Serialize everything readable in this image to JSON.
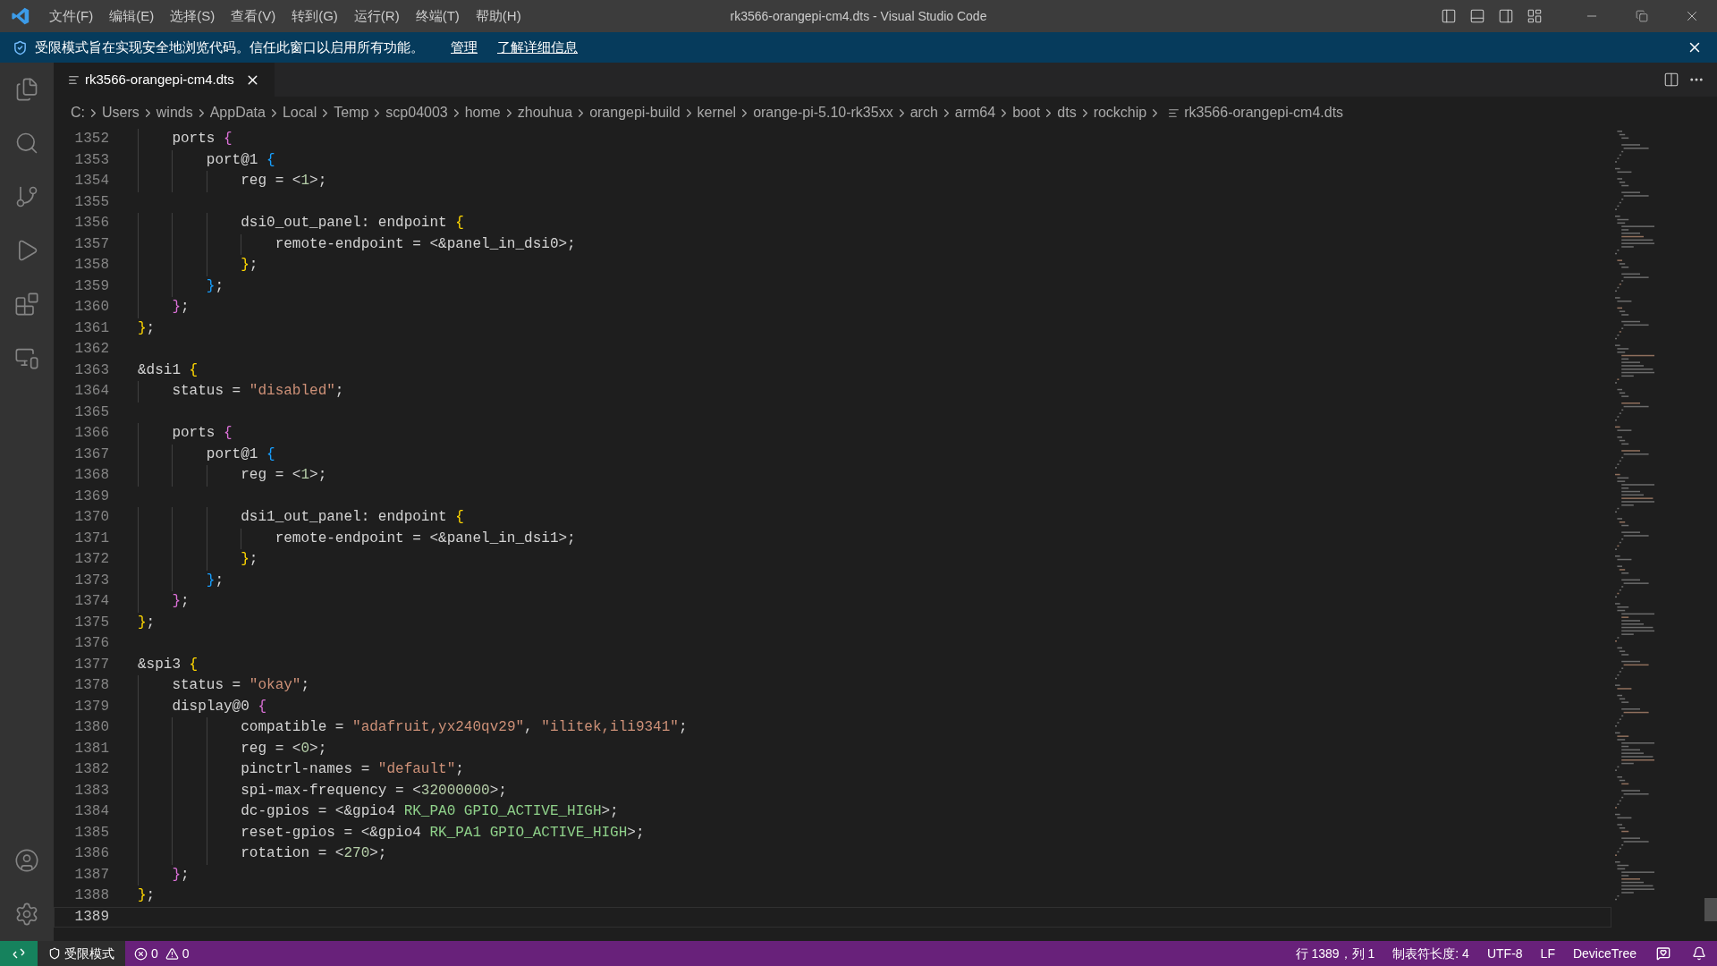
{
  "menu": [
    "文件(F)",
    "编辑(E)",
    "选择(S)",
    "查看(V)",
    "转到(G)",
    "运行(R)",
    "终端(T)",
    "帮助(H)"
  ],
  "window_title": "rk3566-orangepi-cm4.dts - Visual Studio Code",
  "banner": {
    "message": "受限模式旨在实现安全地浏览代码。信任此窗口以启用所有功能。",
    "links": [
      "管理",
      "了解详细信息"
    ]
  },
  "tabs": [
    {
      "label": "rk3566-orangepi-cm4.dts",
      "selected": true
    }
  ],
  "breadcrumb": [
    "C:",
    "Users",
    "winds",
    "AppData",
    "Local",
    "Temp",
    "scp04003",
    "home",
    "zhouhua",
    "orangepi-build",
    "kernel",
    "orange-pi-5.10-rk35xx",
    "arch",
    "arm64",
    "boot",
    "dts",
    "rockchip",
    "rk3566-orangepi-cm4.dts"
  ],
  "editor": {
    "lines": [
      {
        "number": "1352",
        "current": false,
        "tokens": [
          {
            "text": "    ports ",
            "kind": "plain"
          },
          {
            "text": "{",
            "kind": "b2"
          }
        ]
      },
      {
        "number": "1353",
        "current": false,
        "tokens": [
          {
            "text": "        port@1 ",
            "kind": "plain"
          },
          {
            "text": "{",
            "kind": "b3"
          }
        ]
      },
      {
        "number": "1354",
        "current": false,
        "tokens": [
          {
            "text": "            reg = <",
            "kind": "plain"
          },
          {
            "text": "1",
            "kind": "number"
          },
          {
            "text": ">;",
            "kind": "plain"
          }
        ]
      },
      {
        "number": "1355",
        "current": false
      },
      {
        "number": "1356",
        "current": false,
        "tokens": [
          {
            "text": "            dsi0_out_panel: endpoint ",
            "kind": "plain"
          },
          {
            "text": "{",
            "kind": "b1"
          }
        ]
      },
      {
        "number": "1357",
        "current": false,
        "tokens": [
          {
            "text": "                remote-endpoint = <&panel_in_dsi0>;",
            "kind": "plain"
          }
        ]
      },
      {
        "number": "1358",
        "current": false,
        "tokens": [
          {
            "text": "            }",
            "kind": "b1"
          },
          {
            "text": ";",
            "kind": "plain"
          }
        ]
      },
      {
        "number": "1359",
        "current": false,
        "tokens": [
          {
            "text": "        }",
            "kind": "b3"
          },
          {
            "text": ";",
            "kind": "plain"
          }
        ]
      },
      {
        "number": "1360",
        "current": false,
        "tokens": [
          {
            "text": "    }",
            "kind": "b2"
          },
          {
            "text": ";",
            "kind": "plain"
          }
        ]
      },
      {
        "number": "1361",
        "current": false,
        "tokens": [
          {
            "text": "}",
            "kind": "b1"
          },
          {
            "text": ";",
            "kind": "plain"
          }
        ]
      },
      {
        "number": "1362",
        "current": false
      },
      {
        "number": "1363",
        "current": false,
        "tokens": [
          {
            "text": "&dsi1 ",
            "kind": "plain"
          },
          {
            "text": "{",
            "kind": "b1"
          }
        ]
      },
      {
        "number": "1364",
        "current": false,
        "tokens": [
          {
            "text": "    status = ",
            "kind": "plain"
          },
          {
            "text": "\"disabled\"",
            "kind": "string"
          },
          {
            "text": ";",
            "kind": "plain"
          }
        ]
      },
      {
        "number": "1365",
        "current": false
      },
      {
        "number": "1366",
        "current": false,
        "tokens": [
          {
            "text": "    ports ",
            "kind": "plain"
          },
          {
            "text": "{",
            "kind": "b2"
          }
        ]
      },
      {
        "number": "1367",
        "current": false,
        "tokens": [
          {
            "text": "        port@1 ",
            "kind": "plain"
          },
          {
            "text": "{",
            "kind": "b3"
          }
        ]
      },
      {
        "number": "1368",
        "current": false,
        "tokens": [
          {
            "text": "            reg = <",
            "kind": "plain"
          },
          {
            "text": "1",
            "kind": "number"
          },
          {
            "text": ">;",
            "kind": "plain"
          }
        ]
      },
      {
        "number": "1369",
        "current": false
      },
      {
        "number": "1370",
        "current": false,
        "tokens": [
          {
            "text": "            dsi1_out_panel: endpoint ",
            "kind": "plain"
          },
          {
            "text": "{",
            "kind": "b1"
          }
        ]
      },
      {
        "number": "1371",
        "current": false,
        "tokens": [
          {
            "text": "                remote-endpoint = <&panel_in_dsi1>;",
            "kind": "plain"
          }
        ]
      },
      {
        "number": "1372",
        "current": false,
        "tokens": [
          {
            "text": "            }",
            "kind": "b1"
          },
          {
            "text": ";",
            "kind": "plain"
          }
        ]
      },
      {
        "number": "1373",
        "current": false,
        "tokens": [
          {
            "text": "        }",
            "kind": "b3"
          },
          {
            "text": ";",
            "kind": "plain"
          }
        ]
      },
      {
        "number": "1374",
        "current": false,
        "tokens": [
          {
            "text": "    }",
            "kind": "b2"
          },
          {
            "text": ";",
            "kind": "plain"
          }
        ]
      },
      {
        "number": "1375",
        "current": false,
        "tokens": [
          {
            "text": "}",
            "kind": "b1"
          },
          {
            "text": ";",
            "kind": "plain"
          }
        ]
      },
      {
        "number": "1376",
        "current": false
      },
      {
        "number": "1377",
        "current": false,
        "tokens": [
          {
            "text": "&spi3 ",
            "kind": "plain"
          },
          {
            "text": "{",
            "kind": "b1"
          }
        ]
      },
      {
        "number": "1378",
        "current": false,
        "tokens": [
          {
            "text": "    status = ",
            "kind": "plain"
          },
          {
            "text": "\"okay\"",
            "kind": "string"
          },
          {
            "text": ";",
            "kind": "plain"
          }
        ]
      },
      {
        "number": "1379",
        "current": false,
        "tokens": [
          {
            "text": "    display@0 ",
            "kind": "plain"
          },
          {
            "text": "{",
            "kind": "b2"
          }
        ]
      },
      {
        "number": "1380",
        "current": false,
        "tokens": [
          {
            "text": "            compatible = ",
            "kind": "plain"
          },
          {
            "text": "\"adafruit,yx240qv29\"",
            "kind": "string"
          },
          {
            "text": ", ",
            "kind": "plain"
          },
          {
            "text": "\"ilitek,ili9341\"",
            "kind": "string"
          },
          {
            "text": ";",
            "kind": "plain"
          }
        ]
      },
      {
        "number": "1381",
        "current": false,
        "tokens": [
          {
            "text": "            reg = <",
            "kind": "plain"
          },
          {
            "text": "0",
            "kind": "number"
          },
          {
            "text": ">;",
            "kind": "plain"
          }
        ]
      },
      {
        "number": "1382",
        "current": false,
        "tokens": [
          {
            "text": "            pinctrl-names = ",
            "kind": "plain"
          },
          {
            "text": "\"default\"",
            "kind": "string"
          },
          {
            "text": ";",
            "kind": "plain"
          }
        ]
      },
      {
        "number": "1383",
        "current": false,
        "tokens": [
          {
            "text": "            spi-max-frequency = <",
            "kind": "plain"
          },
          {
            "text": "32000000",
            "kind": "number"
          },
          {
            "text": ">;",
            "kind": "plain"
          }
        ]
      },
      {
        "number": "1384",
        "current": false,
        "tokens": [
          {
            "text": "            dc-gpios = <&gpio4 ",
            "kind": "plain"
          },
          {
            "text": "RK_PA0 GPIO_ACTIVE_HIGH",
            "kind": "constant"
          },
          {
            "text": ">;",
            "kind": "plain"
          }
        ]
      },
      {
        "number": "1385",
        "current": false,
        "tokens": [
          {
            "text": "            reset-gpios = <&gpio4 ",
            "kind": "plain"
          },
          {
            "text": "RK_PA1 GPIO_ACTIVE_HIGH",
            "kind": "constant"
          },
          {
            "text": ">;",
            "kind": "plain"
          }
        ]
      },
      {
        "number": "1386",
        "current": false,
        "tokens": [
          {
            "text": "            rotation = <",
            "kind": "plain"
          },
          {
            "text": "270",
            "kind": "number"
          },
          {
            "text": ">;",
            "kind": "plain"
          }
        ]
      },
      {
        "number": "1387",
        "current": false,
        "tokens": [
          {
            "text": "    }",
            "kind": "b2"
          },
          {
            "text": ";",
            "kind": "plain"
          }
        ]
      },
      {
        "number": "1388",
        "current": false,
        "tokens": [
          {
            "text": "}",
            "kind": "b1"
          },
          {
            "text": ";",
            "kind": "plain"
          }
        ]
      },
      {
        "number": "1389",
        "current": true
      }
    ]
  },
  "status_bar": {
    "restricted": "受限模式",
    "errors": "0",
    "warnings": "0",
    "items": [
      "行 1389，列 1",
      "制表符长度: 4",
      "UTF-8",
      "LF",
      "DeviceTree"
    ]
  }
}
